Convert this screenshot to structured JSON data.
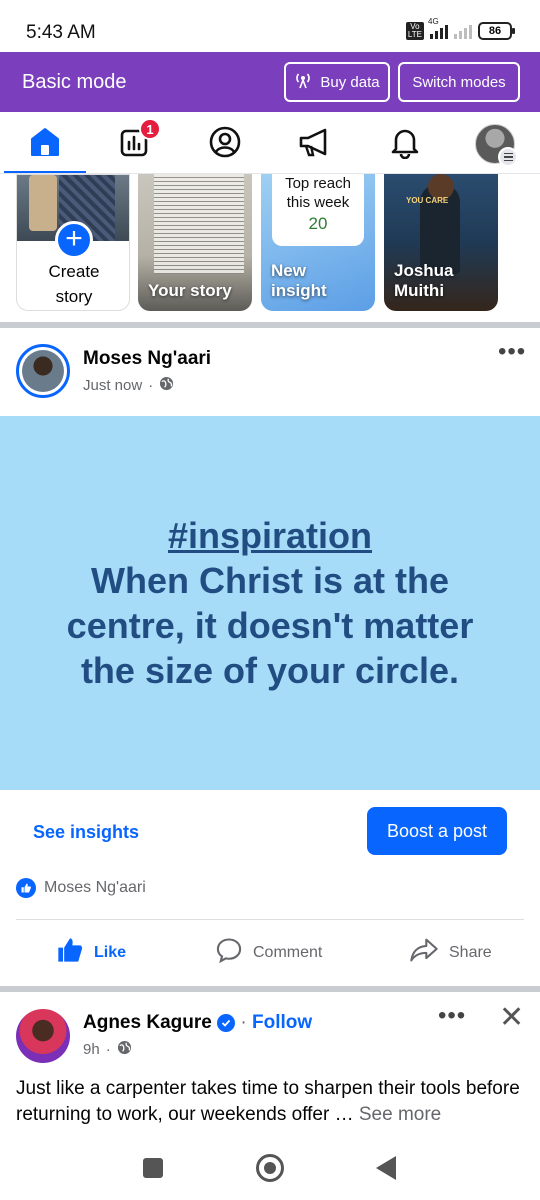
{
  "status_bar": {
    "time": "5:43 AM",
    "network": "4G",
    "volte": "Vo LTE",
    "battery": "86"
  },
  "mode_bar": {
    "title": "Basic mode",
    "buy_data": "Buy data",
    "switch_modes": "Switch modes"
  },
  "nav": {
    "items": [
      {
        "name": "home",
        "active": true
      },
      {
        "name": "insights",
        "badge": "1"
      },
      {
        "name": "profile"
      },
      {
        "name": "ads"
      },
      {
        "name": "notifications"
      },
      {
        "name": "menu"
      }
    ]
  },
  "stories": [
    {
      "label": "Create story"
    },
    {
      "label": "Your story"
    },
    {
      "label": "New insight",
      "card_title": "Top reach this week",
      "card_value": "20"
    },
    {
      "label": "Joshua Muithi",
      "overlay_text": "YOU CARE"
    }
  ],
  "post1": {
    "author": "Moses Ng'aari",
    "time": "Just now",
    "hashtag": "#inspiration",
    "text": "When Christ is at the centre, it doesn't matter the size of your circle.",
    "see_insights": "See insights",
    "boost": "Boost a post",
    "liked_by": "Moses Ng'aari",
    "actions": {
      "like": "Like",
      "comment": "Comment",
      "share": "Share"
    }
  },
  "post2": {
    "author": "Agnes Kagure",
    "follow": "Follow",
    "follow_sep": "·",
    "time": "9h",
    "text": "Just like a carpenter takes time to sharpen their tools before returning to work, our weekends offer …",
    "see_more": "See more"
  },
  "colors": {
    "brand_blue": "#0866ff",
    "mode_bar": "#7b3fbe",
    "post_bg": "#a6dcf7",
    "post_text": "#214d82"
  }
}
